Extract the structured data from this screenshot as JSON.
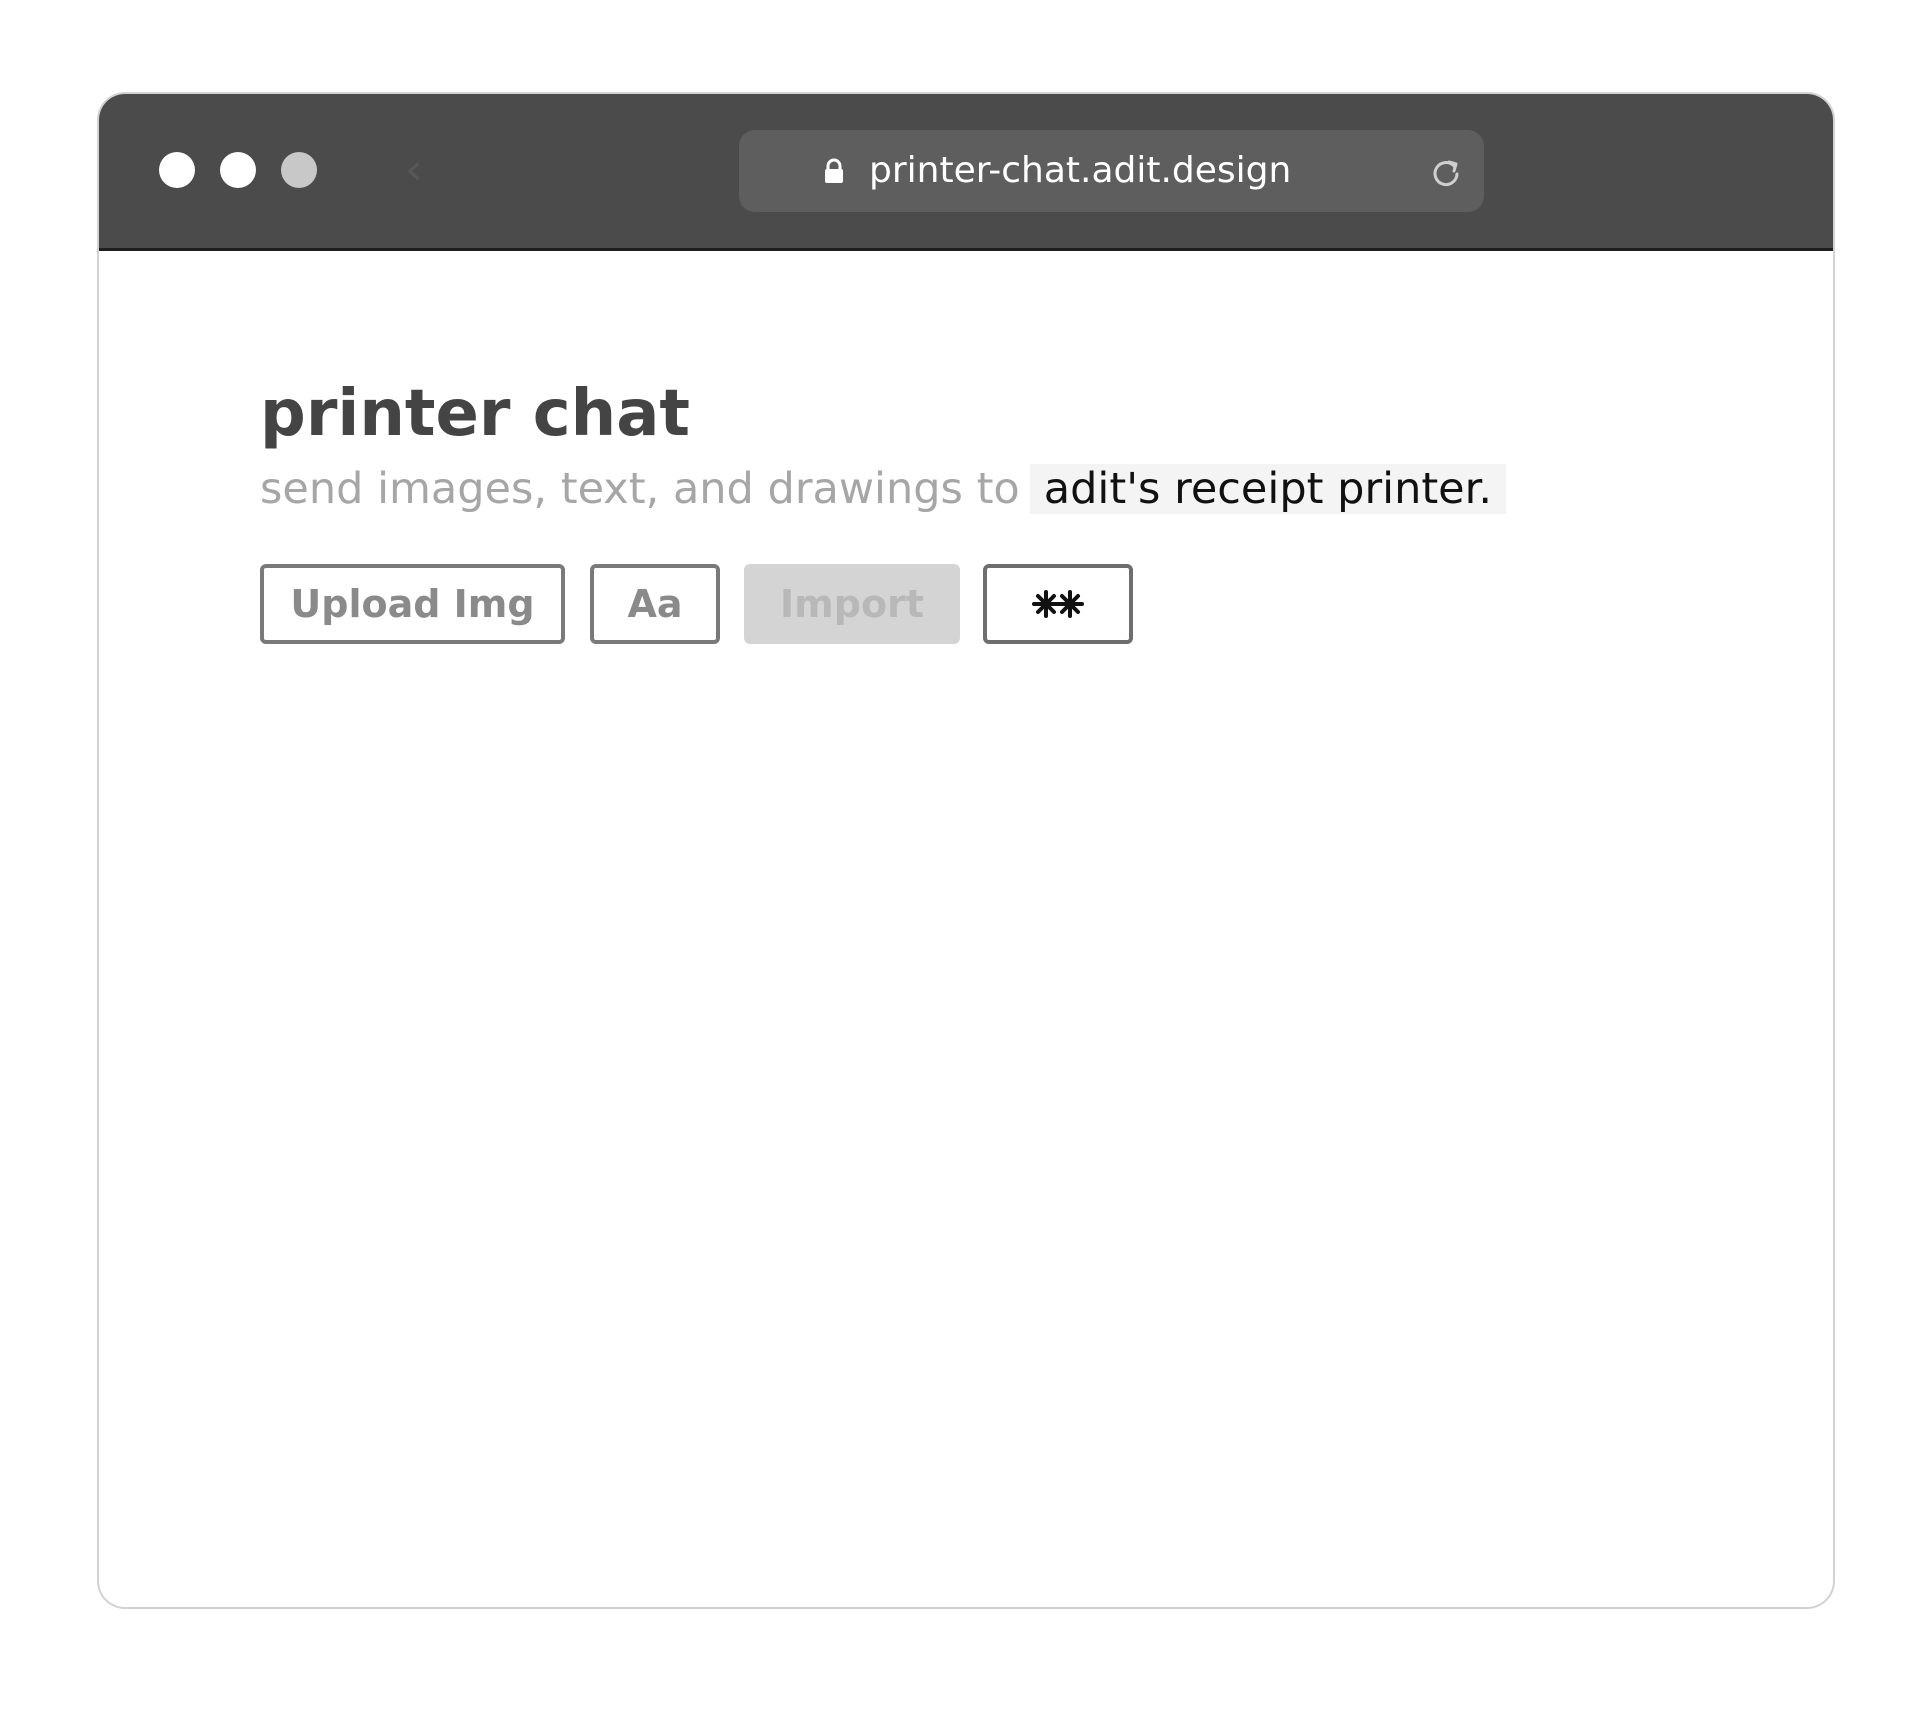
{
  "browser": {
    "url": "printer-chat.adit.design",
    "back_glyph": "‹"
  },
  "page": {
    "title": "printer chat",
    "subtitle_text": "send images, text, and drawings to",
    "subtitle_highlight": "adit's receipt printer."
  },
  "toolbar": {
    "upload_label": "Upload Img",
    "text_label": "Aa",
    "import_label": "Import",
    "draw_icon": "sparkle-icon"
  },
  "colors": {
    "titlebar": "#4b4b4b",
    "addressbar": "#5e5e5e",
    "title_text": "#444444",
    "subtitle_muted": "#a6a6a6",
    "button_border": "#7a7a7a",
    "import_disabled_bg": "#d4d4d4"
  }
}
